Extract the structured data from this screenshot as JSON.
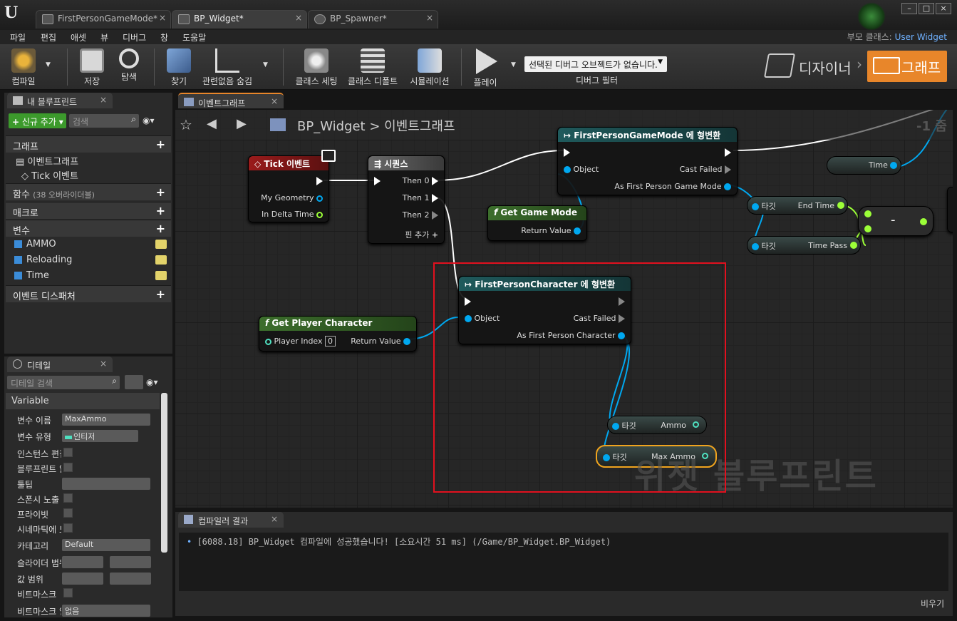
{
  "tabs": [
    {
      "label": "FirstPersonGameMode*"
    },
    {
      "label": "BP_Widget*"
    },
    {
      "label": "BP_Spawner*"
    }
  ],
  "menu": [
    "파일",
    "편집",
    "애셋",
    "뷰",
    "디버그",
    "창",
    "도움말"
  ],
  "parent_class": {
    "label": "부모 클래스:",
    "value": "User Widget"
  },
  "toolbar": {
    "compile": "컴파일",
    "save": "저장",
    "browse": "탐색",
    "find": "찾기",
    "hide_unrelated": "관련없음 숨김",
    "class_settings": "클래스 세팅",
    "class_defaults": "클래스 디폴트",
    "simulation": "시뮬레이션",
    "play": "플레이",
    "debug_select": "선택된 디버그 오브젝트가 없습니다.",
    "debug_filter": "디버그 필터",
    "designer": "디자이너",
    "graph": "그래프"
  },
  "my_blueprint": {
    "tab": "내 블루프린트",
    "add_new": "신규 추가",
    "search_placeholder": "검색",
    "graphs_header": "그래프",
    "event_graph": "이벤트그래프",
    "tick_event": "Tick 이벤트",
    "functions_header": "함수",
    "functions_count": "(38 오버라이더블)",
    "macros_header": "매크로",
    "variables_header": "변수",
    "variables": [
      "AMMO",
      "Reloading",
      "Time"
    ],
    "dispatchers_header": "이벤트 디스패처"
  },
  "details": {
    "tab": "디테일",
    "search_placeholder": "디테일 검색",
    "section": "Variable",
    "rows": [
      "변수 이름",
      "변수 유형",
      "인스턴스 편집",
      "블루프린트 읽",
      "툴팁",
      "스폰시 노출",
      "프라이빗",
      "시네마틱에 노",
      "카테고리",
      "슬라이더 범위",
      "값 범위",
      "비트마스크",
      "비트마스크 열"
    ],
    "var_name": "MaxAmmo",
    "var_type": "인티저",
    "category": "Default",
    "bitmask_enum": "없음"
  },
  "graph_tab": "이벤트그래프",
  "breadcrumb": {
    "root": "BP_Widget",
    "sep": ">",
    "graph": "이벤트그래프"
  },
  "zoom": "-1 줌",
  "nodes": {
    "tick": {
      "title": "Tick 이벤트",
      "pins": [
        "My Geometry",
        "In Delta Time"
      ]
    },
    "sequence": {
      "title": "시퀀스",
      "pins": [
        "Then 0",
        "Then 1",
        "Then 2",
        "핀 추가"
      ]
    },
    "cast_gm": {
      "title": "FirstPersonGameMode 에 형변환",
      "pins": [
        "Object",
        "Cast Failed",
        "As First Person Game Mode"
      ]
    },
    "get_gm": {
      "title": "Get Game Mode",
      "pins": [
        "Return Value"
      ]
    },
    "time": {
      "label": "Time"
    },
    "endtime": {
      "target": "타깃",
      "label": "End Time"
    },
    "timepass": {
      "target": "타깃",
      "label": "Time Pass"
    },
    "minus": {
      "label": "-"
    },
    "cast_fpc": {
      "title": "FirstPersonCharacter 에 형변환",
      "pins": [
        "Object",
        "Cast Failed",
        "As First Person Character"
      ]
    },
    "get_pc": {
      "title": "Get Player Character",
      "pins": [
        "Player Index",
        "Return Value"
      ],
      "index": "0"
    },
    "ammo": {
      "target": "타깃",
      "label": "Ammo"
    },
    "maxammo": {
      "target": "타깃",
      "label": "Max Ammo"
    }
  },
  "watermark": "위젯 블루프린트",
  "compiler": {
    "tab": "컴파일러 결과",
    "message": "[6088.18] BP_Widget 컴파일에 성공했습니다! [소요시간 51 ms] (/Game/BP_Widget.BP_Widget)",
    "clear": "비우기"
  },
  "colors": {
    "accent": "#e8862a",
    "highlight": "#e2101e",
    "object_pin": "#00a8f0",
    "float_pin": "#9cff38"
  }
}
